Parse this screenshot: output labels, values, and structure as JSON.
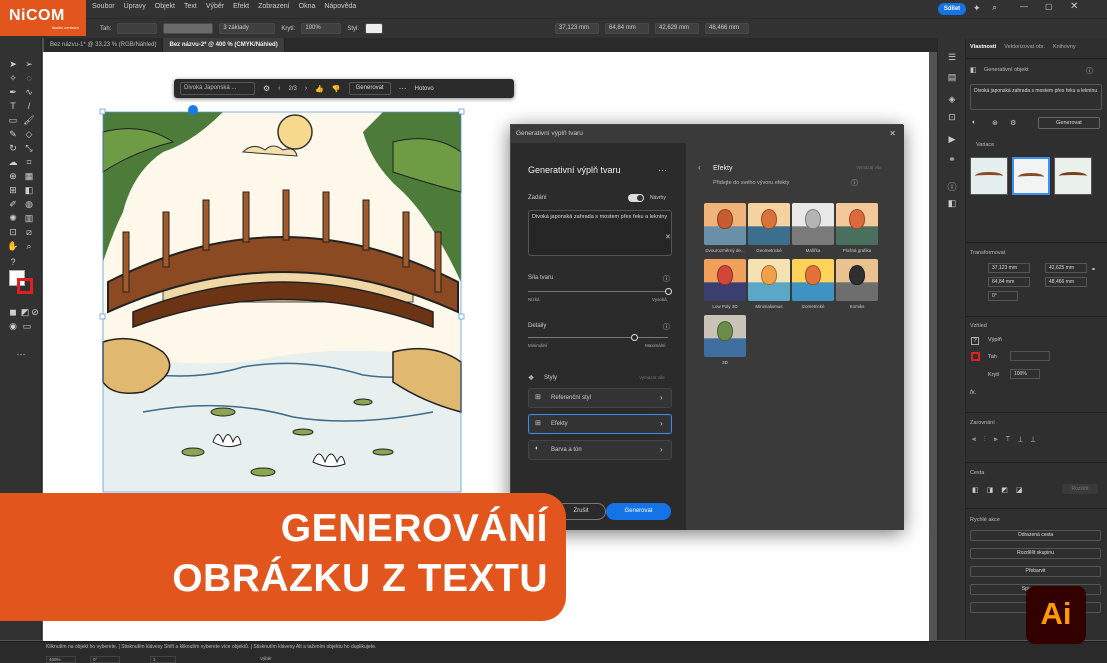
{
  "brand": {
    "logo": "NiCOM",
    "logo_sub": "školicí centrum",
    "accent": "#e2561e"
  },
  "menu": [
    "Soubor",
    "Úpravy",
    "Objekt",
    "Text",
    "Výběr",
    "Efekt",
    "Zobrazení",
    "Okna",
    "Nápověda"
  ],
  "header_right": {
    "share_label": "Sdílet"
  },
  "options_bar": {
    "stroke_label": "Tah:",
    "brush_label": "3 základy",
    "opacity_label": "Krytí:",
    "opacity_value": "100%",
    "style_label": "Styl:",
    "x_value": "37,123 mm",
    "y_value": "64,84 mm",
    "w_value": "42,629 mm",
    "h_value": "48,466 mm"
  },
  "tabs": [
    {
      "label": "Bez názvu-1* @ 33,23 % (RGB/Náhled)"
    },
    {
      "label": "Bez názvu-2* @ 400 % (CMYK/Náhled)"
    }
  ],
  "context_bar": {
    "prompt_preview": "Divoká Japonská ...",
    "pager": "2/3",
    "generate_label": "Generovat",
    "done_label": "Hotovo"
  },
  "dialog": {
    "title": "Generativní výplň tvaru",
    "heading": "Generativní výplň tvaru",
    "prompt_label": "Zadání",
    "suggestions_label": "Návrhy",
    "prompt_text": "Divoká japonská zahrada s mostem přes řeku a lekníny",
    "shape_strength_label": "Síla tvaru",
    "shape_min": "Nízká",
    "shape_max": "Vysoká",
    "detail_label": "Detaily",
    "detail_min": "Minimální",
    "detail_max": "Maximální",
    "styles_label": "Styly",
    "styles_clear": "Vymazat vše",
    "style_buttons": [
      "Referenční styl",
      "Efekty",
      "Barva a tón"
    ],
    "cancel_label": "Zrušit",
    "generate_label": "Generovat",
    "effects_title": "Efekty",
    "effects_clear": "Vymazat vše",
    "effects_subtitle": "Přidejte do svého vývoru efekty",
    "effects": [
      {
        "label": "Dvourozměrný de..."
      },
      {
        "label": "Geometrické"
      },
      {
        "label": "Malířka"
      },
      {
        "label": "Plošná grafika"
      },
      {
        "label": "Low Poly 3D"
      },
      {
        "label": "Minimalismus"
      },
      {
        "label": "Izometrické"
      },
      {
        "label": "Komiks"
      },
      {
        "label": "3D"
      }
    ]
  },
  "properties": {
    "tabs": [
      "Vlastnosti",
      "Vektorizovat obr.",
      "Knihovny"
    ],
    "object_type": "Generativní objekt",
    "prompt_text": "Divoká japonská zahrada s mostem přes řeku a leknínu",
    "generate_label": "Generovat",
    "variants_label": "Variace",
    "transform_label": "Transformovat",
    "x_value": "37,123 mm",
    "y_value": "64,84 mm",
    "w_value": "42,625 mm",
    "h_value": "48,466 mm",
    "angle_value": "0°",
    "appearance_label": "Vzhled",
    "fill_label": "Výplň",
    "stroke_label": "Tah",
    "opacity_label": "Krytí",
    "opacity_value": "100%",
    "fx_label": "fx.",
    "align_label": "Zarovnání",
    "pathfinder_label": "Cesta",
    "expand_label": "Rozšířit",
    "quick_actions_label": "Rychlé akce",
    "quick_actions": [
      "Odrazená cesta",
      "Rozdělit skupinu",
      "Přebarvit",
      "Spustit glo...",
      "Gene..."
    ]
  },
  "status_bar": {
    "zoom": "400%",
    "angle": "0°",
    "artboard": "1",
    "mode": "Výběr",
    "hint": "Kliknutím na objekt ho vyberete. | Stisknutím klávesy Shift a kliknutím vyberete více objektů. | Stisknutím klávesy Alt a tažením objektu ho duplikujete."
  },
  "banner": {
    "line1": "GENEROVÁNÍ",
    "line2": "OBRÁZKU Z TEXTU"
  },
  "ai_logo": {
    "label": "Ai",
    "bg": "#330000",
    "fg": "#ff9a00"
  }
}
